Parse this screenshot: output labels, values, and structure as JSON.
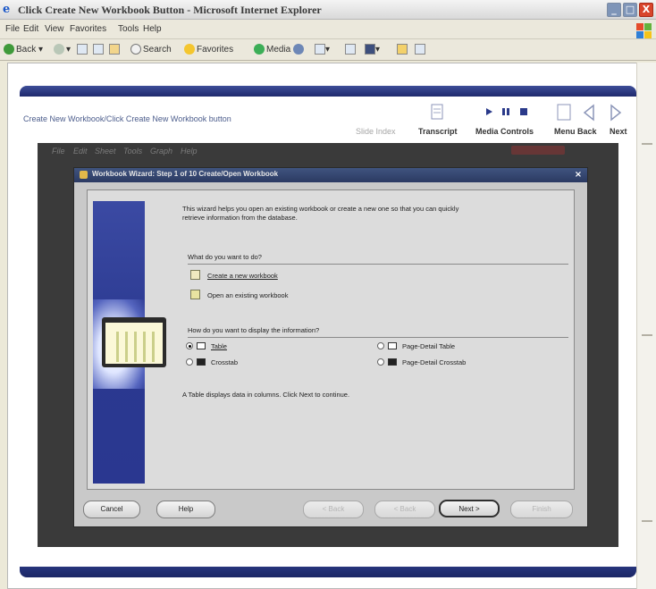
{
  "window": {
    "title": "Click Create New Workbook Button - Microsoft Internet Explorer",
    "min_glyph": "_",
    "max_glyph": "□",
    "close_glyph": "X"
  },
  "menu": [
    "File",
    "Edit",
    "View",
    "Favorites",
    "Tools",
    "Help"
  ],
  "toolbar": {
    "back": "Back",
    "search": "Search",
    "favorites": "Favorites",
    "media": "Media"
  },
  "player": {
    "breadcrumb": "Create New Workbook/Click Create New Workbook button",
    "slide_label": "Slide Index",
    "transcript": "Transcript",
    "media_controls": "Media Controls",
    "menu_back": "Menu Back",
    "next": "Next"
  },
  "app_menu": [
    "File",
    "Edit",
    "Sheet",
    "Tools",
    "Graph",
    "Help"
  ],
  "wizard": {
    "title": "Workbook Wizard: Step 1 of 10 Create/Open Workbook",
    "close_glyph": "×",
    "intro_line1": "This wizard helps you open an existing workbook or create a new one so that you can quickly",
    "intro_line2": "retrieve information from the database.",
    "q1": "What do you want to do?",
    "opt_create": "Create a new workbook",
    "opt_open": "Open an existing workbook",
    "q2": "How do you want to display the information?",
    "display": {
      "table": "Table",
      "crosstab": "Crosstab",
      "page_detail_table": "Page-Detail Table",
      "page_detail_crosstab": "Page-Detail Crosstab"
    },
    "hint": "A Table displays data in columns. Click Next to continue.",
    "buttons": {
      "cancel": "Cancel",
      "help": "Help",
      "previous": "< Back",
      "back": "< Back",
      "next": "Next >",
      "finish": "Finish"
    }
  }
}
